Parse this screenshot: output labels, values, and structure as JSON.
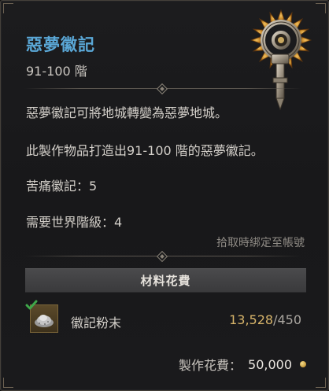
{
  "item": {
    "name": "惡夢徽記",
    "tier": "91-100 階",
    "name_color": "#5aa7d6"
  },
  "description": {
    "line1": "惡夢徽記可將地城轉變為惡夢地城。",
    "line2": "此製作物品打造出91-100 階的惡夢徽記。",
    "affix": "苦痛徽記：5",
    "requirement": "需要世界階級：4",
    "bind_note": "拾取時綁定至帳號"
  },
  "materials": {
    "header": "材料花費",
    "items": [
      {
        "name": "徽記粉末",
        "have": "13,528",
        "separator": "/",
        "need": "450",
        "icon": "sigil-powder-icon",
        "fulfilled": true
      }
    ]
  },
  "craft": {
    "label": "製作花費：",
    "cost": "50,000",
    "currency_icon": "gold-coin-icon"
  },
  "colors": {
    "accent": "#5aa7d6",
    "have_amount": "#d7b46a",
    "check": "#3fa84a"
  }
}
